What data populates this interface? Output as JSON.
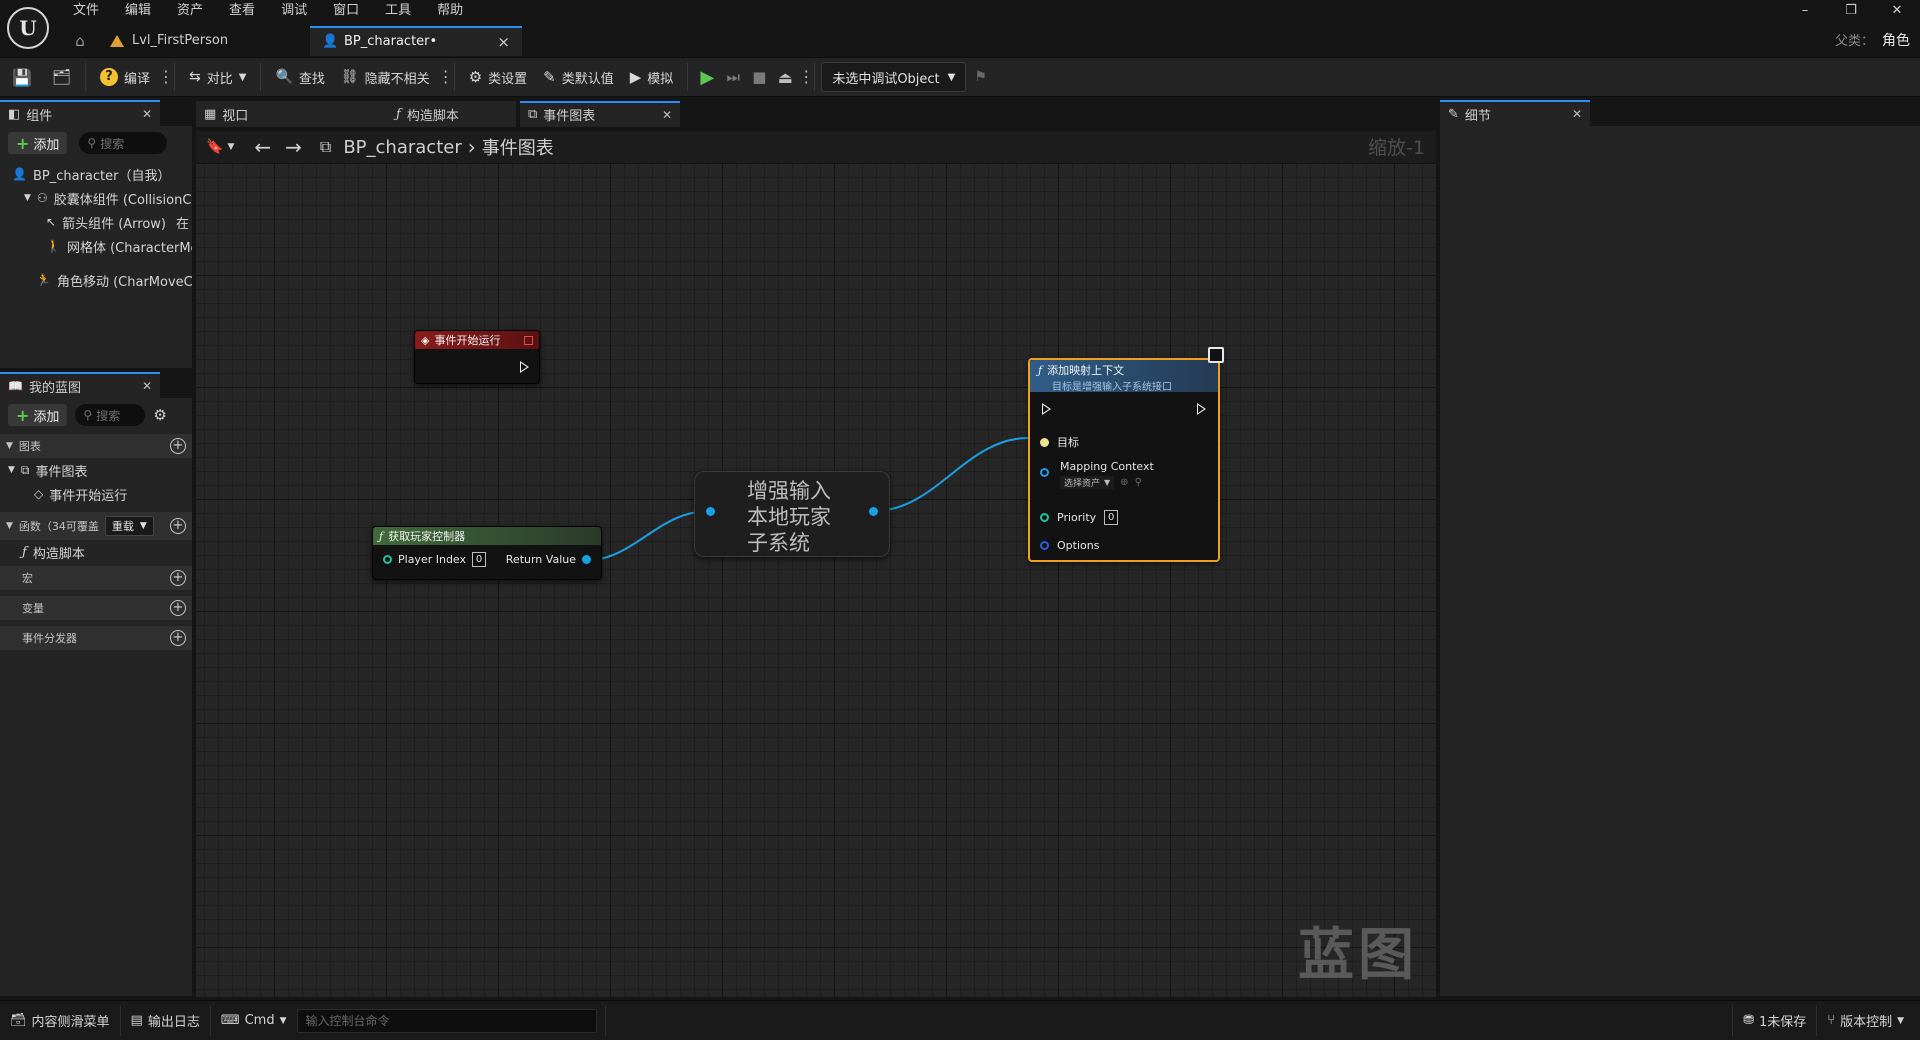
{
  "menu": [
    "文件",
    "编辑",
    "资产",
    "查看",
    "调试",
    "窗口",
    "工具",
    "帮助"
  ],
  "logo_text": "U",
  "window_controls": {
    "minimize": "–",
    "restore": "❐",
    "close": "✕"
  },
  "parent": {
    "label": "父类：",
    "value": "角色"
  },
  "doc_tabs": [
    {
      "label": "Lvl_FirstPerson"
    },
    {
      "label": "BP_character•",
      "close": "×"
    }
  ],
  "toolbar": {
    "compile": "编译",
    "diff": "对比",
    "find": "查找",
    "hide_unrelated": "隐藏不相关",
    "class_settings": "类设置",
    "class_defaults": "类默认值",
    "simulate": "模拟",
    "debug_object": "未选中调试Object"
  },
  "components_panel": {
    "tab": "组件",
    "add": "添加",
    "search_placeholder": "搜索",
    "items": [
      "BP_character（自我）",
      "胶囊体组件 (CollisionC",
      "箭头组件 (Arrow)",
      "网格体 (CharacterMe",
      "角色移动 (CharMoveC"
    ],
    "edit_suffix": "在"
  },
  "my_blueprint": {
    "tab": "我的蓝图",
    "add": "添加",
    "search_placeholder": "搜索",
    "graphs_label": "图表",
    "event_graph": "事件图表",
    "begin_play": "事件开始运行",
    "functions_label": "函数（34可覆盖",
    "override_dd": "重载",
    "construction_script": "构造脚本",
    "macros_label": "宏",
    "variables_label": "变量",
    "dispatchers_label": "事件分发器"
  },
  "editor_tabs": [
    {
      "label": "视口"
    },
    {
      "label": "构造脚本"
    },
    {
      "label": "事件图表"
    }
  ],
  "breadcrumb": {
    "root": "BP_character",
    "sep": "›",
    "current": "事件图表"
  },
  "zoom": "缩放-1",
  "watermark": "蓝图",
  "nodes": {
    "begin_play": {
      "title": "事件开始运行"
    },
    "get_player_controller": {
      "title": "获取玩家控制器",
      "pin_in": "Player Index",
      "pin_in_value": "0",
      "pin_out": "Return Value"
    },
    "enhanced_input": {
      "line1": "增强输入",
      "line2": "本地玩家",
      "line3": "子系统"
    },
    "add_mapping_context": {
      "title": "添加映射上下文",
      "subtitle": "目标是增强输入子系统接口",
      "target": "目标",
      "mapping_context": "Mapping Context",
      "select_asset": "选择资产",
      "priority": "Priority",
      "priority_value": "0",
      "options": "Options"
    }
  },
  "details_panel": {
    "tab": "细节"
  },
  "statusbar": {
    "content_drawer": "内容侧滑菜单",
    "output_log": "输出日志",
    "cmd": "Cmd",
    "cmd_placeholder": "输入控制台命令",
    "unsaved": "1未保存",
    "source_control": "版本控制"
  },
  "colors": {
    "accent": "#2a8ef5",
    "event_red": "#8a1c1c",
    "pure_green": "#3f6a3a",
    "func_blue": "#2f5d88",
    "select_orange": "#f0a020",
    "wire_blue": "#1aa0e6"
  }
}
